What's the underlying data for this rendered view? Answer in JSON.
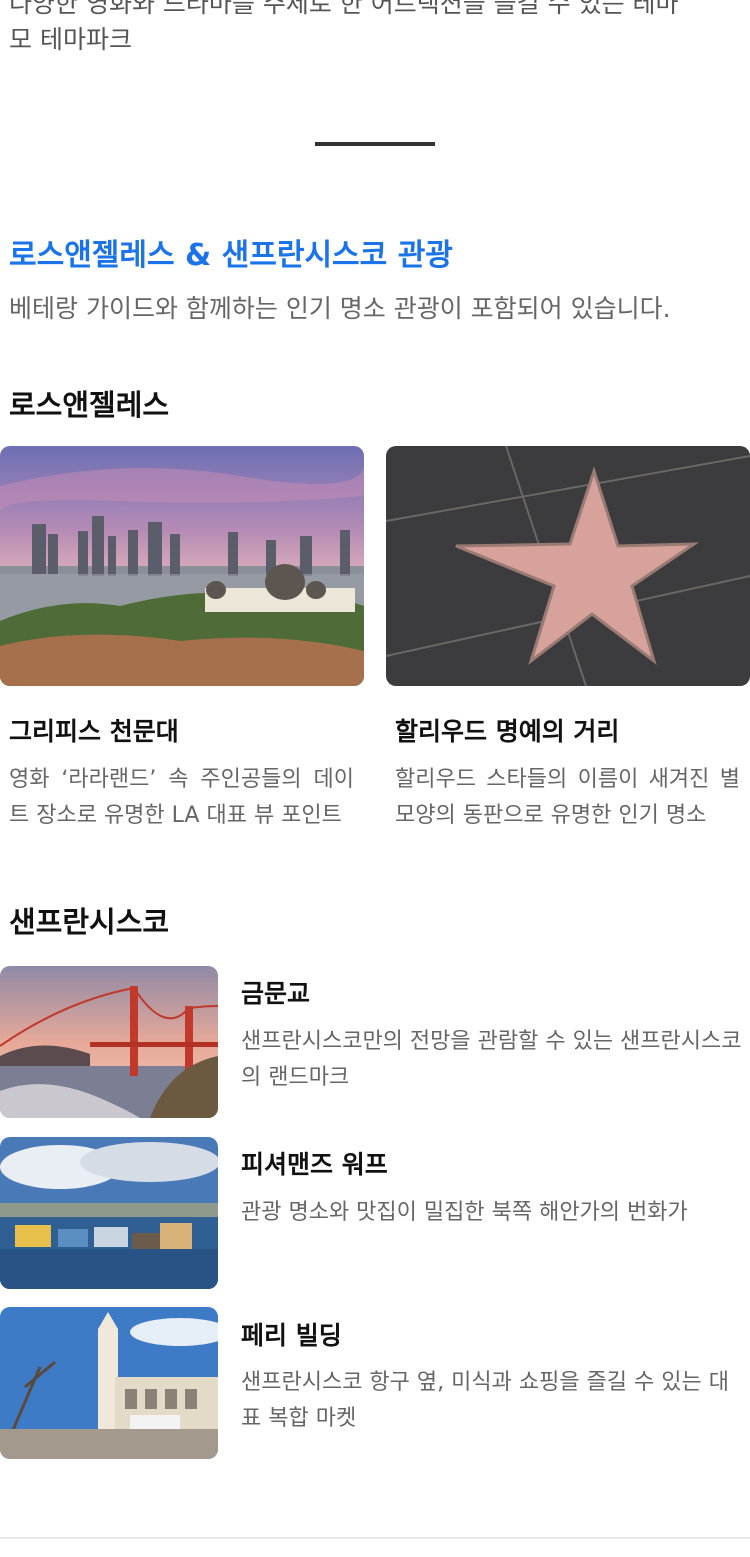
{
  "intro": {
    "line_partial": "다양한 영화와 드라마를 주제로 한 어트랙션을 즐길 수 있는 테마",
    "line2": "모 테마파크"
  },
  "section": {
    "title": "로스앤젤레스 & 샌프란시스코 관광",
    "subtitle": "베테랑 가이드와 함께하는 인기 명소 관광이 포함되어 있습니다."
  },
  "la": {
    "title": "로스앤젤레스",
    "cards": [
      {
        "title": "그리피스 천문대",
        "desc": "영화 ‘라라랜드’ 속 주인공들의 데이트 장소로 유명한 LA 대표 뷰 포인트"
      },
      {
        "title": "할리우드 명예의 거리",
        "desc": "할리우드 스타들의 이름이 새겨진 별 모양의 동판으로 유명한 인기 명소"
      }
    ]
  },
  "sf": {
    "title": "샌프란시스코",
    "items": [
      {
        "title": "금문교",
        "desc": "샌프란시스코만의 전망을 관람할 수 있는 샌프란시스코의 랜드마크"
      },
      {
        "title": "피셔맨즈 워프",
        "desc": "관광 명소와 맛집이 밀집한 북쪽 해안가의 번화가"
      },
      {
        "title": "페리 빌딩",
        "desc": "샌프란시스코 항구 옆, 미식과 쇼핑을 즐길 수 있는 대표 복합 마켓"
      }
    ]
  }
}
